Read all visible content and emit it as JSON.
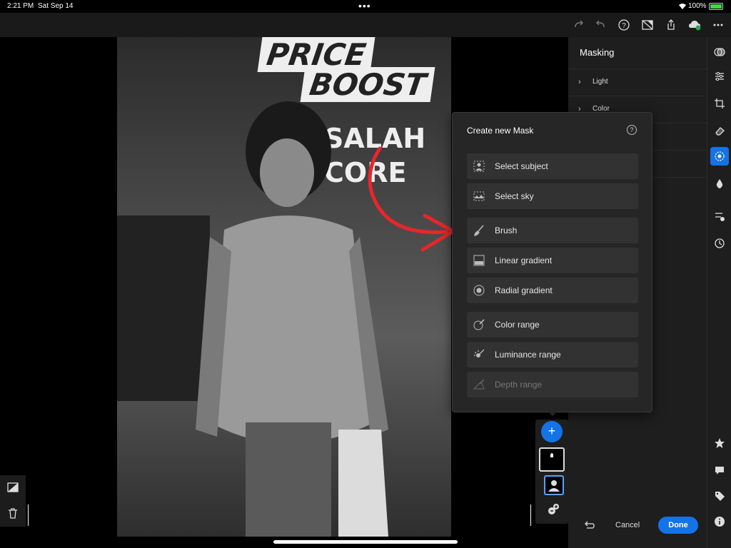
{
  "status_bar": {
    "time": "2:21 PM",
    "date": "Sat Sep 14",
    "battery_percent": "100%",
    "battery_color": "#3fd93f"
  },
  "toolbar": {
    "icons": [
      "redo-icon",
      "undo-icon",
      "help-icon",
      "compare-off-icon",
      "share-icon",
      "cloud-sync-icon",
      "more-icon"
    ]
  },
  "photo": {
    "sign_price": "PRICE",
    "sign_boost": "BOOST",
    "sign_salah": "SALAH",
    "sign_score": "CORE"
  },
  "panel": {
    "title": "Masking",
    "sections": [
      {
        "label": "Light"
      },
      {
        "label": "Color"
      }
    ]
  },
  "popup": {
    "title": "Create new Mask",
    "options": [
      {
        "label": "Select subject",
        "icon": "subject-icon",
        "enabled": true
      },
      {
        "label": "Select sky",
        "icon": "sky-icon",
        "enabled": true
      },
      {
        "label": "Brush",
        "icon": "brush-icon",
        "enabled": true
      },
      {
        "label": "Linear gradient",
        "icon": "linear-gradient-icon",
        "enabled": true
      },
      {
        "label": "Radial gradient",
        "icon": "radial-gradient-icon",
        "enabled": true
      },
      {
        "label": "Color range",
        "icon": "color-range-icon",
        "enabled": true
      },
      {
        "label": "Luminance range",
        "icon": "luminance-range-icon",
        "enabled": true
      },
      {
        "label": "Depth range",
        "icon": "depth-range-icon",
        "enabled": false
      }
    ]
  },
  "mask_strip": {
    "add_label": "+"
  },
  "footer": {
    "cancel_label": "Cancel",
    "done_label": "Done"
  },
  "accent_color": "#1473e6",
  "annotation_arrow_color": "#e8262a"
}
